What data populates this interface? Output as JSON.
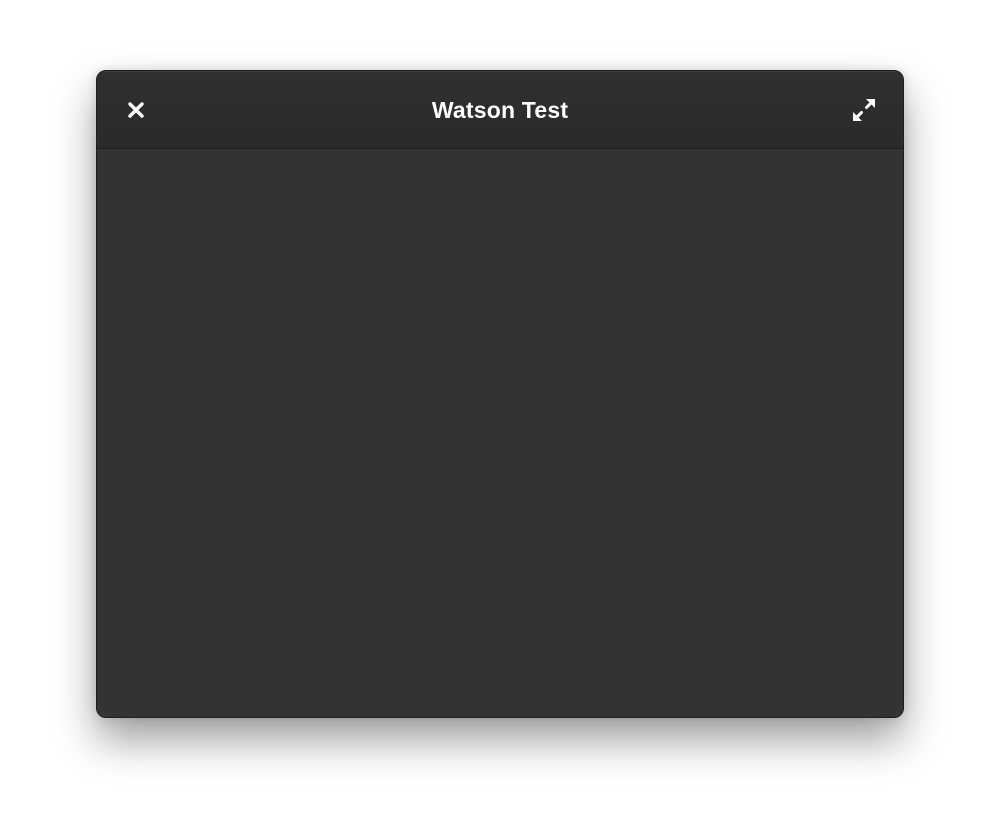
{
  "window": {
    "title": "Watson Test",
    "close_icon": "close-icon",
    "expand_icon": "expand-icon"
  },
  "colors": {
    "background": "#ffffff",
    "window_body": "#333333",
    "titlebar": "#2d2d2d",
    "title_text": "#ffffff"
  }
}
